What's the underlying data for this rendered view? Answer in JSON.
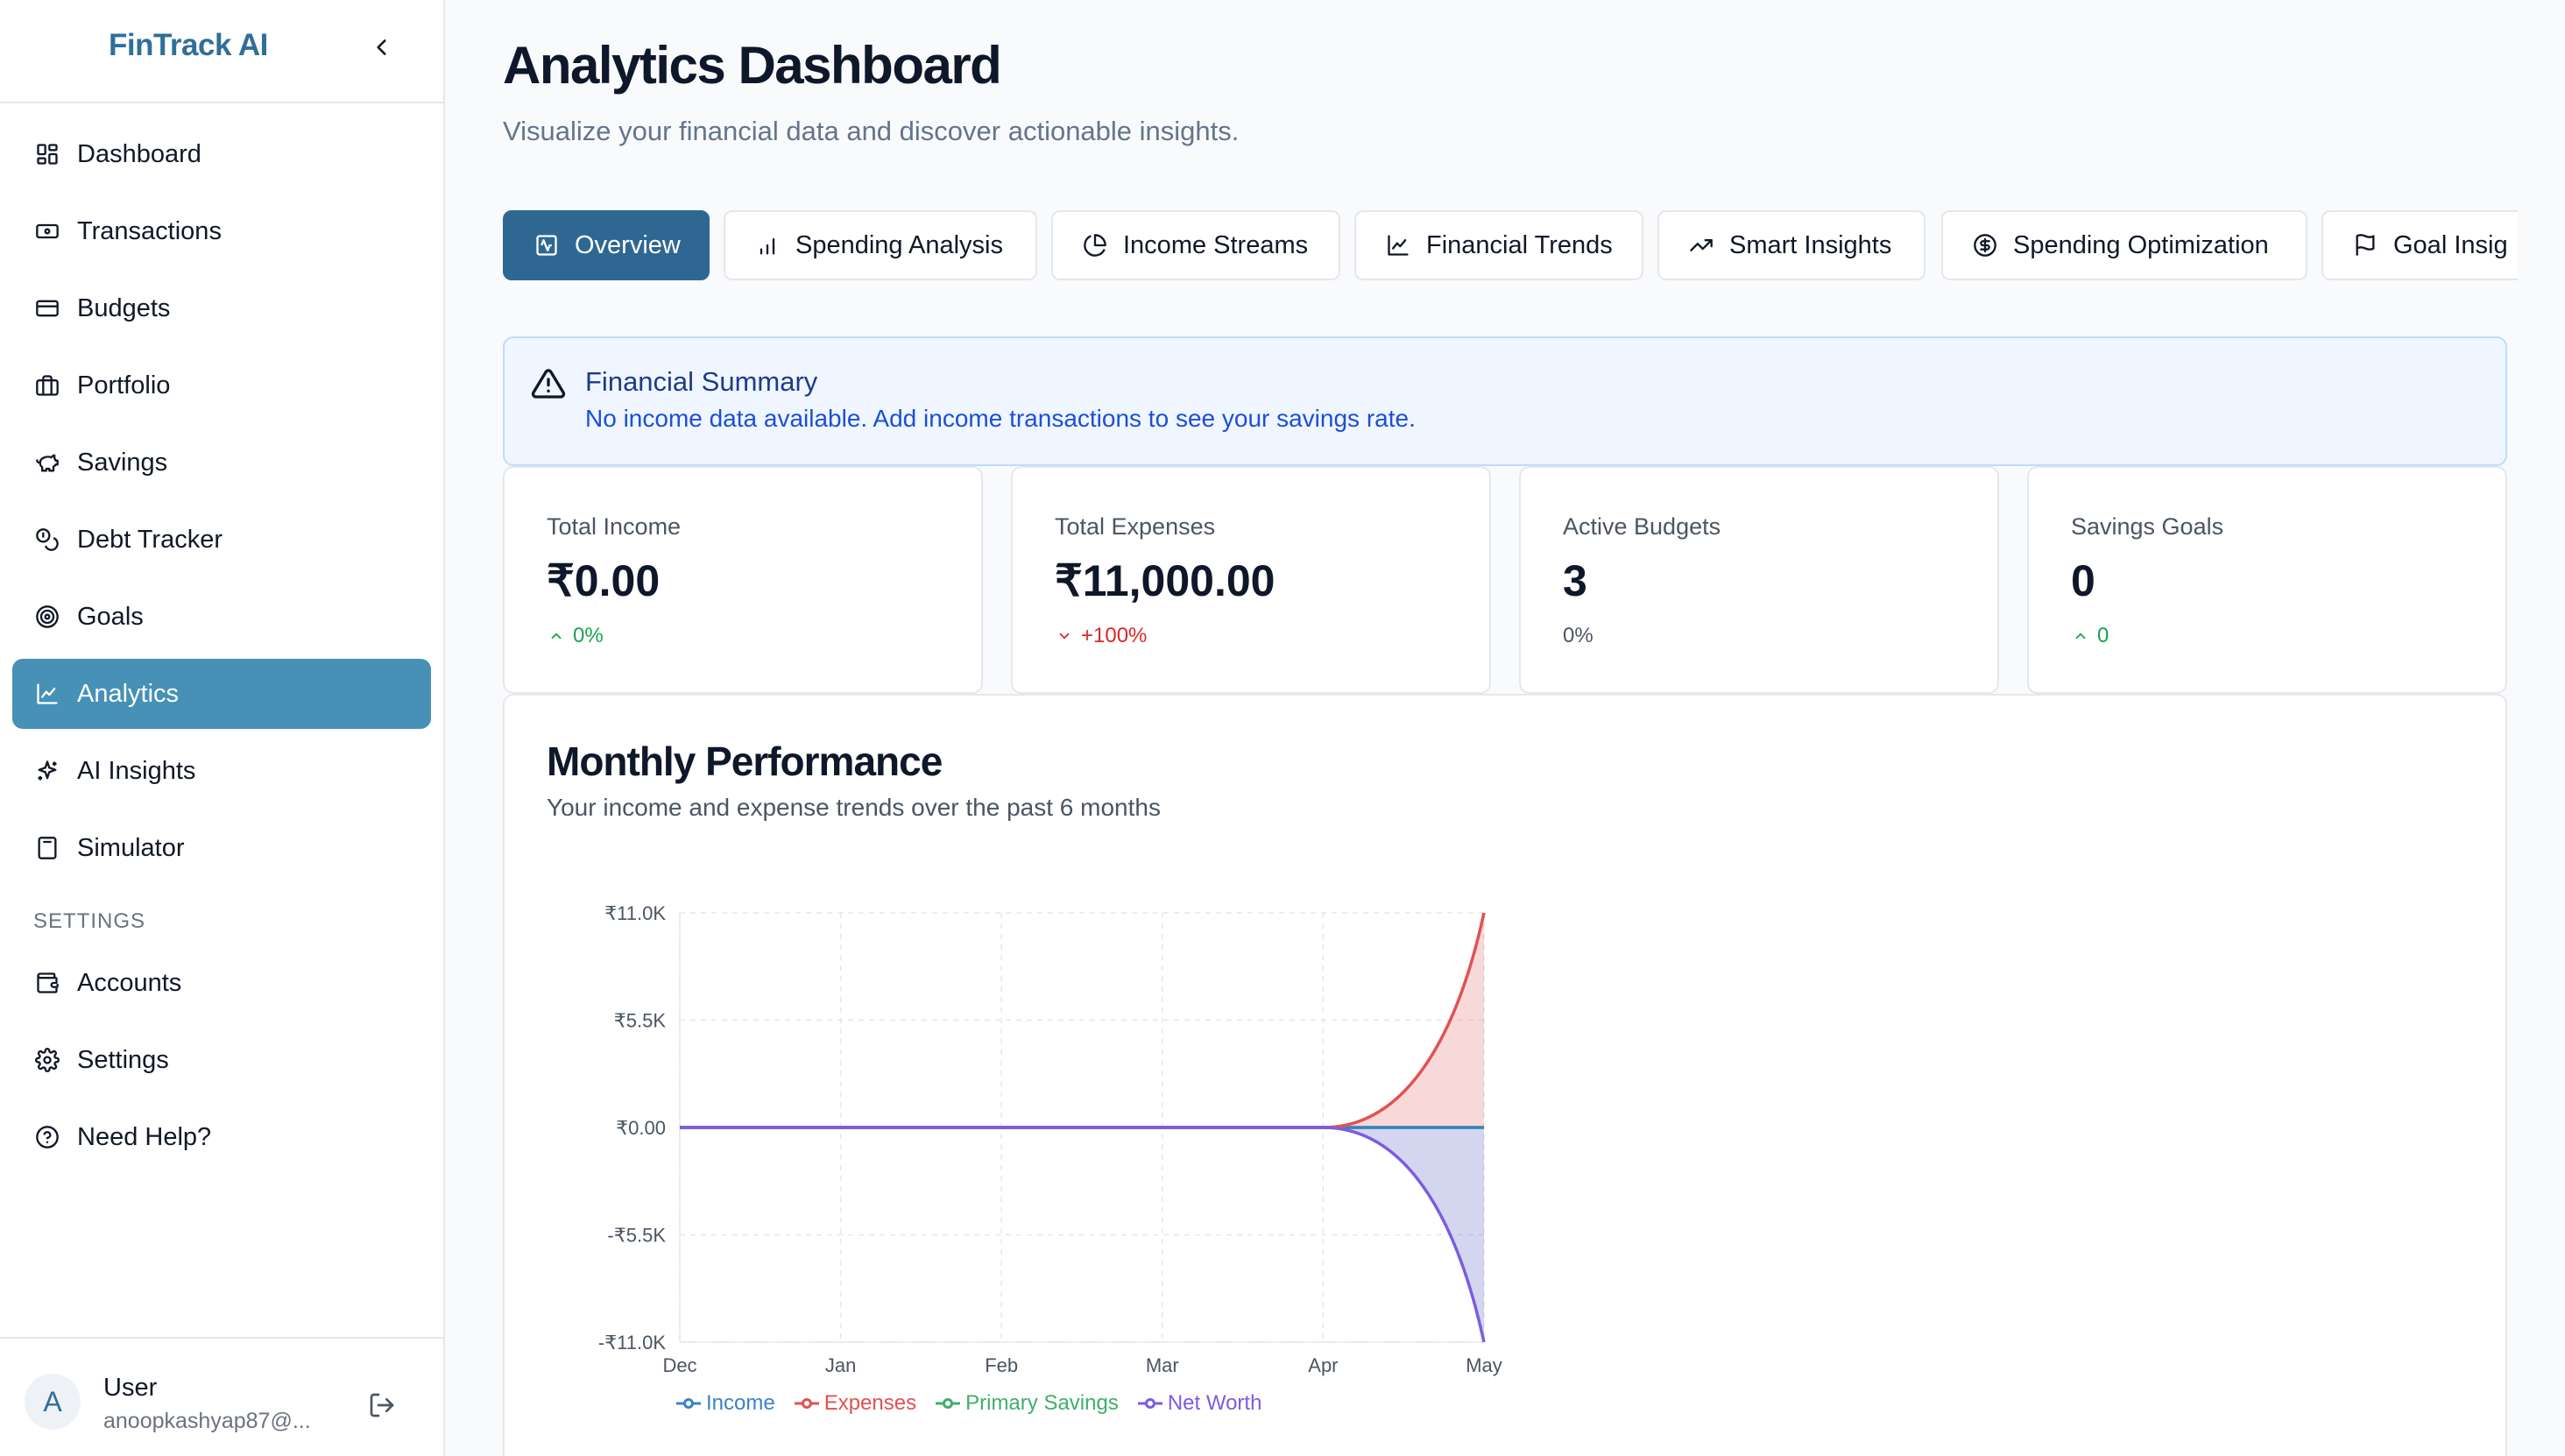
{
  "app": {
    "brand": "FinTrack AI"
  },
  "sidebar": {
    "items": [
      {
        "label": "Dashboard",
        "icon": "dashboard-grid-icon"
      },
      {
        "label": "Transactions",
        "icon": "banknote-icon"
      },
      {
        "label": "Budgets",
        "icon": "credit-card-icon"
      },
      {
        "label": "Portfolio",
        "icon": "briefcase-icon"
      },
      {
        "label": "Savings",
        "icon": "piggy-bank-icon"
      },
      {
        "label": "Debt Tracker",
        "icon": "coins-icon"
      },
      {
        "label": "Goals",
        "icon": "target-icon"
      },
      {
        "label": "Analytics",
        "icon": "line-chart-icon",
        "active": true
      },
      {
        "label": "AI Insights",
        "icon": "sparkles-icon"
      },
      {
        "label": "Simulator",
        "icon": "calculator-icon"
      }
    ],
    "settings_heading": "SETTINGS",
    "settings_items": [
      {
        "label": "Accounts",
        "icon": "wallet-icon"
      },
      {
        "label": "Settings",
        "icon": "gear-icon"
      },
      {
        "label": "Need Help?",
        "icon": "help-circle-icon"
      }
    ],
    "user": {
      "initial": "A",
      "name": "User",
      "email": "anoopkashyap87@..."
    }
  },
  "header": {
    "title": "Analytics Dashboard",
    "subtitle": "Visualize your financial data and discover actionable insights."
  },
  "tabs": [
    {
      "label": "Overview",
      "icon": "activity-square-icon",
      "active": true
    },
    {
      "label": "Spending Analysis",
      "icon": "bar-chart-icon"
    },
    {
      "label": "Income Streams",
      "icon": "pie-chart-icon"
    },
    {
      "label": "Financial Trends",
      "icon": "line-chart-icon"
    },
    {
      "label": "Smart Insights",
      "icon": "trending-up-icon"
    },
    {
      "label": "Spending Optimization",
      "icon": "dollar-circle-icon"
    },
    {
      "label": "Goal Insig",
      "icon": "flag-icon"
    }
  ],
  "alert": {
    "title": "Financial Summary",
    "text": "No income data available. Add income transactions to see your savings rate."
  },
  "cards": [
    {
      "label": "Total Income",
      "value": "₹0.00",
      "delta": "0%",
      "trend": "up"
    },
    {
      "label": "Total Expenses",
      "value": "₹11,000.00",
      "delta": "+100%",
      "trend": "down"
    },
    {
      "label": "Active Budgets",
      "value": "3",
      "delta": "0%",
      "trend": "neutral"
    },
    {
      "label": "Savings Goals",
      "value": "0",
      "delta": "0",
      "trend": "up"
    }
  ],
  "performance": {
    "title": "Monthly Performance",
    "subtitle": "Your income and expense trends over the past 6 months"
  },
  "colors": {
    "income": "#3b82c4",
    "expenses": "#e05252",
    "primary_savings": "#3fae6b",
    "net_worth": "#7c5ce0",
    "active_nav": "#4691b5",
    "active_tab": "#2f6793"
  },
  "chart_data": {
    "type": "area",
    "categories": [
      "Dec",
      "Jan",
      "Feb",
      "Mar",
      "Apr",
      "May"
    ],
    "ylim": [
      -11000,
      11000
    ],
    "yticks": [
      -11000,
      -5500,
      0,
      5500,
      11000
    ],
    "ytick_labels": [
      "-₹11.0K",
      "-₹5.5K",
      "₹0.00",
      "₹5.5K",
      "₹11.0K"
    ],
    "grid": true,
    "legend_position": "bottom",
    "series": [
      {
        "name": "Income",
        "values": [
          0,
          0,
          0,
          0,
          0,
          0
        ]
      },
      {
        "name": "Expenses",
        "values": [
          0,
          0,
          0,
          0,
          0,
          11000
        ]
      },
      {
        "name": "Primary Savings",
        "values": [
          0,
          0,
          0,
          0,
          0,
          0
        ]
      },
      {
        "name": "Net Worth",
        "values": [
          0,
          0,
          0,
          0,
          0,
          -11000
        ]
      }
    ]
  }
}
